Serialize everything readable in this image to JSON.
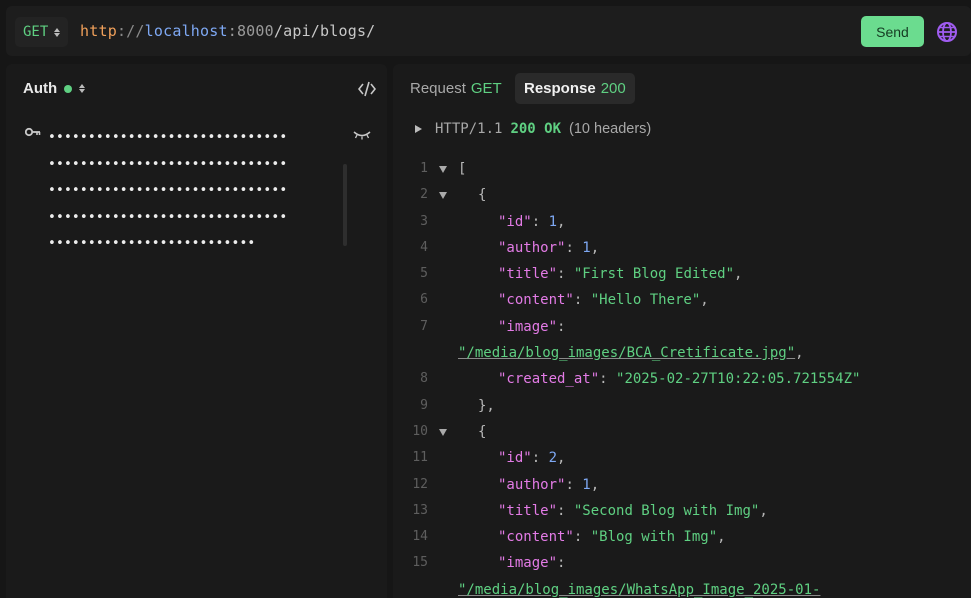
{
  "request": {
    "method": "GET",
    "url": {
      "scheme": "http",
      "separator": "://",
      "host": "localhost",
      "port": ":8000",
      "path": "/api/blogs/"
    },
    "send_label": "Send"
  },
  "auth": {
    "title": "Auth",
    "password_lines": [
      "••••••••••••••••••••••••••••••",
      "••••••••••••••••••••••••••••••",
      "••••••••••••••••••••••••••••••",
      "••••••••••••••••••••••••••••••",
      "••••••••••••••••••••••••••"
    ]
  },
  "tabs": {
    "request": {
      "label": "Request",
      "status": "GET"
    },
    "response": {
      "label": "Response",
      "status": "200"
    }
  },
  "response": {
    "version": "HTTP/1.1",
    "status": "200 OK",
    "headers_count": "(10 headers)"
  },
  "body_lines": [
    {
      "n": "1",
      "fold": true,
      "indent": 0,
      "text": "["
    },
    {
      "n": "2",
      "fold": true,
      "indent": 1,
      "text": "{"
    },
    {
      "n": "3",
      "indent": 2,
      "key": "\"id\"",
      "num": "1"
    },
    {
      "n": "4",
      "indent": 2,
      "key": "\"author\"",
      "num": "1"
    },
    {
      "n": "5",
      "indent": 2,
      "key": "\"title\"",
      "str": "\"First Blog Edited\""
    },
    {
      "n": "6",
      "indent": 2,
      "key": "\"content\"",
      "str": "\"Hello There\""
    },
    {
      "n": "7",
      "indent": 2,
      "key": "\"image\"",
      "wrap": true
    },
    {
      "n": "",
      "indent": 0,
      "link": "\"/media/blog_images/BCA_Cretificate.jpg\"",
      "comma": true
    },
    {
      "n": "8",
      "indent": 2,
      "key": "\"created_at\"",
      "str": "\"2025-02-27T10:22:05.721554Z\"",
      "last": true
    },
    {
      "n": "9",
      "indent": 1,
      "text": "},"
    },
    {
      "n": "10",
      "fold": true,
      "indent": 1,
      "text": "{"
    },
    {
      "n": "11",
      "indent": 2,
      "key": "\"id\"",
      "num": "2"
    },
    {
      "n": "12",
      "indent": 2,
      "key": "\"author\"",
      "num": "1"
    },
    {
      "n": "13",
      "indent": 2,
      "key": "\"title\"",
      "str": "\"Second Blog with Img\""
    },
    {
      "n": "14",
      "indent": 2,
      "key": "\"content\"",
      "str": "\"Blog with Img\""
    },
    {
      "n": "15",
      "indent": 2,
      "key": "\"image\"",
      "wrap": true
    },
    {
      "n": "",
      "indent": 0,
      "link": "\"/media/blog_images/WhatsApp_Image_2025-01-",
      "comma": false
    }
  ],
  "colors": {
    "accent_green": "#5fd082",
    "send_bg": "#6bdc8f",
    "key": "#e37be6",
    "number": "#7ea8f3",
    "scheme": "#f0a05a"
  },
  "icons": [
    "chevron-updown-icon",
    "globe-icon",
    "code-icon",
    "key-icon",
    "eye-closed-icon",
    "triangle-right-icon",
    "fold-arrow-icon"
  ]
}
